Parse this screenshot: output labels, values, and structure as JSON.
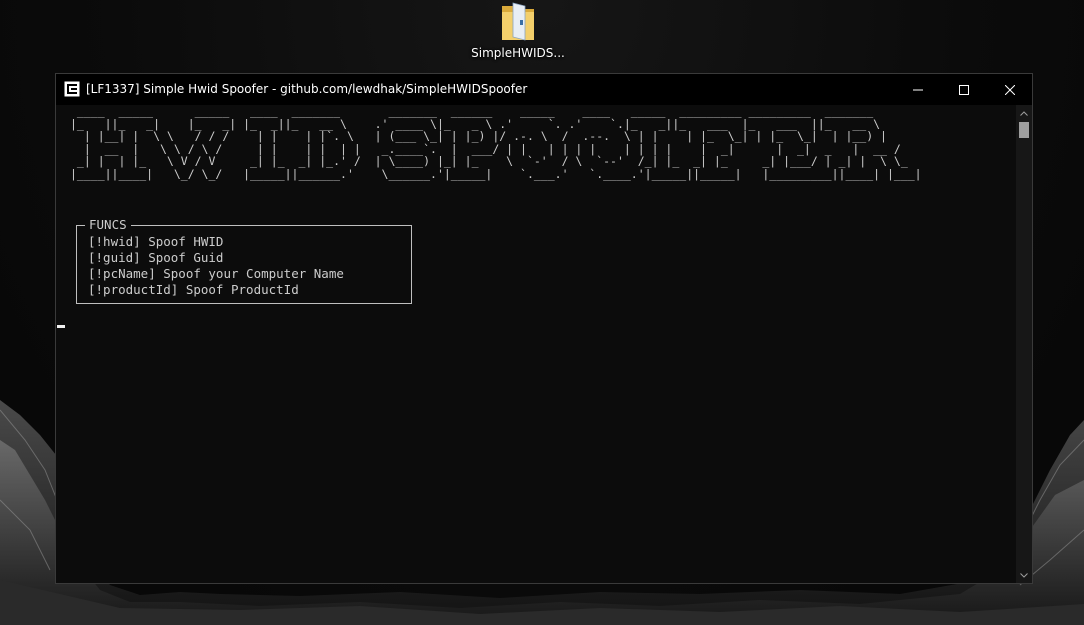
{
  "desktop": {
    "icon": {
      "label": "SimpleHWIDS...",
      "icon_name": "folder-icon"
    }
  },
  "window": {
    "title": "[LF1337] Simple Hwid Spoofer - github.com/lewdhak/SimpleHWIDSpoofer",
    "app_icon": "console-app-icon",
    "controls": {
      "minimize_icon": "minimize-icon",
      "maximize_icon": "maximize-icon",
      "close_icon": "close-icon"
    }
  },
  "console": {
    "banner_lines": [
      " ____  _____      _____   ____  _______       _______  ______    _____    ____   _____  _________ _________  _______",
      "|_   ||_   _|    |_   _| |_  _||_   __ \\    .' ____ \\|_   _ \\ .'     `. .'    `.|_   _||_   ___  |_   ___  ||_   __ \\",
      "  | |__| |  \\ \\   / / /    | |    | |`. \\   | (___ \\_| | |_) |/ .-. \\  /  .--.  \\ | |    | |_  \\_| | |_  \\_|  | |__) |",
      "  |  __  |   \\ \\ / \\ /     | |    | |  | |   _.____`.  |  ___/ | |   | | | |    | | | |    |  _|      |  _|  _   |  __ /",
      " _| |  | |_   \\ V / V     _| |_  _| |_.' /  | \\____) |_| |_    \\  `-'  / \\  `--'  /_| |_  _| |_     _| |___/ | _| |  \\ \\_",
      "|____||____|   \\_/ \\_/   |_____||______.'    \\______.'|_____|    `.___.'   `.____.'|_____||_____|   |_________||____| |___|"
    ],
    "funcs_box": {
      "legend": "FUNCS",
      "items": [
        "[!hwid] Spoof HWID",
        "[!guid] Spoof Guid",
        "[!pcName] Spoof your Computer Name",
        "[!productId] Spoof ProductId"
      ]
    },
    "scrollbar": {
      "up_icon": "scroll-up-arrow-icon",
      "down_icon": "scroll-down-arrow-icon"
    }
  },
  "colors": {
    "console_bg": "#0c0c0c",
    "console_text": "#cccccc",
    "titlebar_bg": "#000000",
    "titlebar_text": "#ffffff"
  }
}
